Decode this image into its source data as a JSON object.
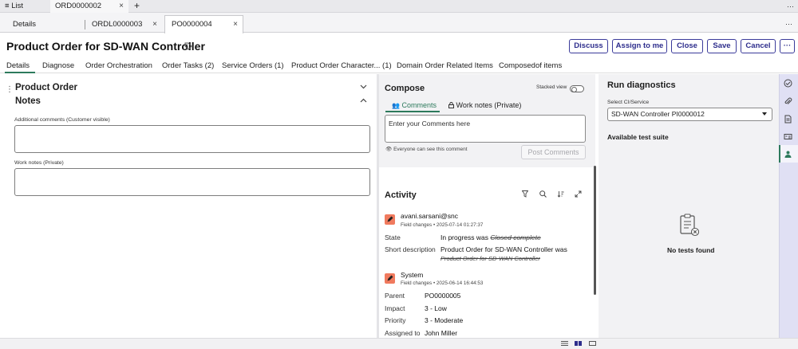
{
  "top_tabs": {
    "list_label": "List",
    "order_tab": "ORD0000002",
    "close": "×",
    "add": "+",
    "more": "···"
  },
  "sub_tabs": {
    "details": "Details",
    "ordl": "ORDL0000003",
    "po": "PO0000004",
    "close": "×",
    "more": "···"
  },
  "header": {
    "title": "Product Order for SD-WAN Controller",
    "buttons": {
      "discuss": "Discuss",
      "assign": "Assign to me",
      "close": "Close",
      "save": "Save",
      "cancel": "Cancel",
      "more": "···"
    }
  },
  "form_tabs": [
    "Details",
    "Diagnose",
    "Order Orchestration",
    "Order Tasks (2)",
    "Service Orders (1)",
    "Product Order Character... (1)",
    "Domain Order Related Items",
    "Composedof items"
  ],
  "form": {
    "section_title": "Product Order",
    "notes_title": "Notes",
    "additional_comments_label": "Additional comments (Customer visible)",
    "work_notes_label": "Work notes (Private)"
  },
  "compose": {
    "title": "Compose",
    "stacked_view": "Stacked view",
    "tab_comments": "Comments",
    "tab_work_notes": "Work notes (Private)",
    "placeholder": "Enter your Comments here",
    "visibility_note": "Everyone can see this comment",
    "post_button": "Post Comments"
  },
  "activity": {
    "title": "Activity",
    "entries": [
      {
        "user": "avani.sarsani@snc",
        "meta": "Field changes • 2025-07-14 01:27:37",
        "fields": [
          {
            "key": "State",
            "value": "In progress was ",
            "old": "Closed complete"
          },
          {
            "key": "Short description",
            "value": "Product Order for SD-WAN Controller was",
            "old": "Product Order for SD-WAN Controller"
          }
        ]
      },
      {
        "user": "System",
        "meta": "Field changes • 2025-06-14 16:44:53",
        "fields": [
          {
            "key": "Parent",
            "value": "PO0000005"
          },
          {
            "key": "Impact",
            "value": "3 - Low"
          },
          {
            "key": "Priority",
            "value": "3 - Moderate"
          },
          {
            "key": "Assigned to",
            "value": "John Miller"
          }
        ]
      }
    ]
  },
  "diagnostics": {
    "title": "Run diagnostics",
    "ci_label": "Select CI/Service",
    "ci_value": "SD-WAN Controller PI0000012",
    "available_title": "Available test suite",
    "empty": "No tests found"
  },
  "colors": {
    "accent": "#2d7a5c",
    "button_border": "#3b3b9a",
    "avatar": "#f07a5e",
    "rail": "#e0e0f4"
  },
  "icons": {
    "rail": [
      "diagnostics-icon",
      "attachment-icon",
      "document-icon",
      "card-icon",
      "user-icon"
    ],
    "activity": [
      "filter-icon",
      "search-icon",
      "sort-icon",
      "expand-icon"
    ],
    "footer": [
      "list-view-icon",
      "split-view-icon",
      "single-view-icon"
    ]
  }
}
